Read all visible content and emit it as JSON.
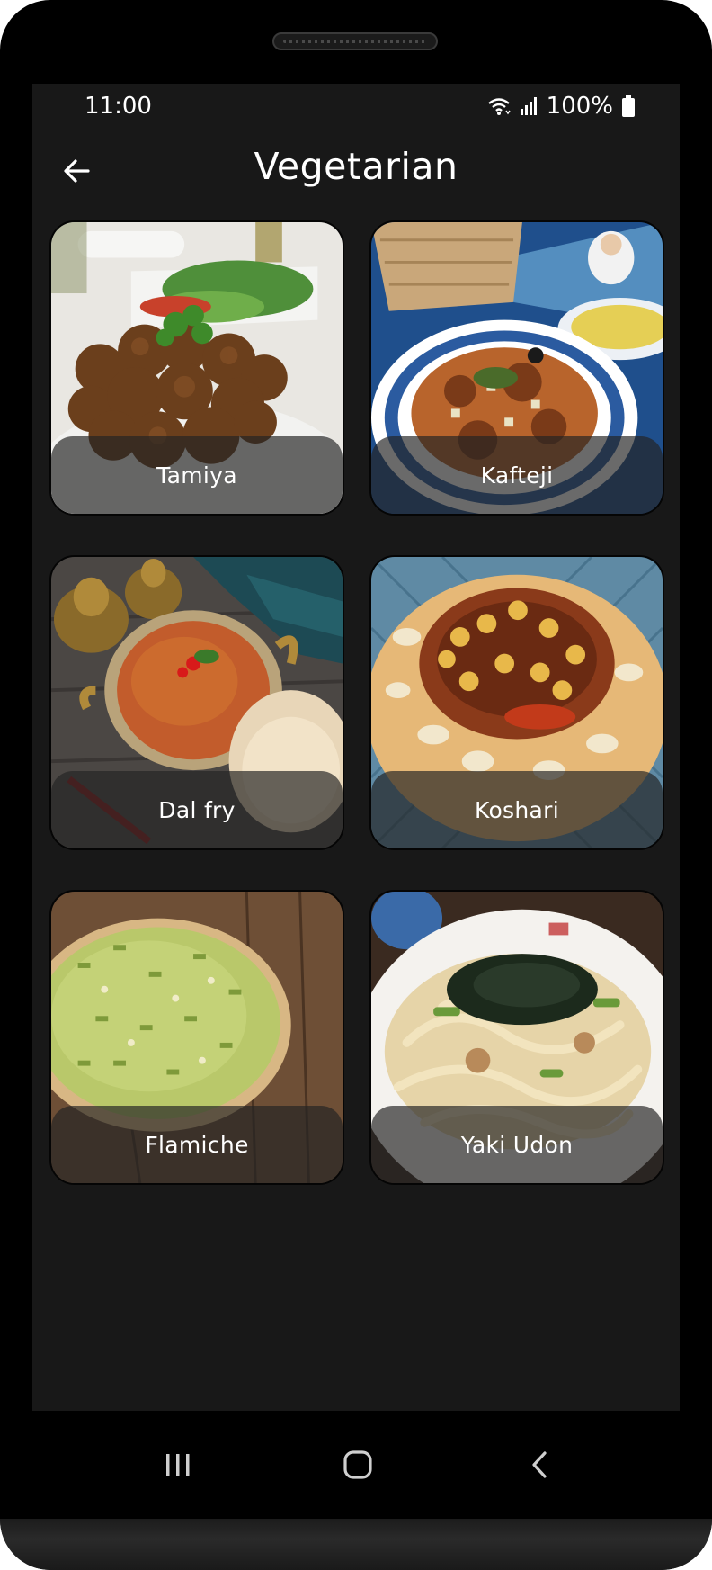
{
  "status_bar": {
    "time": "11:00",
    "battery": "100%",
    "icons": [
      "wifi-icon",
      "signal-icon",
      "battery-icon"
    ]
  },
  "app_bar": {
    "title": "Vegetarian",
    "back_icon": "arrow-left-icon"
  },
  "dishes": [
    {
      "name": "Tamiya"
    },
    {
      "name": "Kafteji"
    },
    {
      "name": "Dal fry"
    },
    {
      "name": "Koshari"
    },
    {
      "name": "Flamiche"
    },
    {
      "name": "Yaki Udon"
    }
  ],
  "nav_bar": {
    "icons": [
      "recent-apps-icon",
      "home-icon",
      "back-icon"
    ]
  },
  "colors": {
    "background": "#181818",
    "phone_frame": "#000000",
    "label_bar": "rgba(35,35,35,0.68)",
    "text": "#ffffff"
  }
}
